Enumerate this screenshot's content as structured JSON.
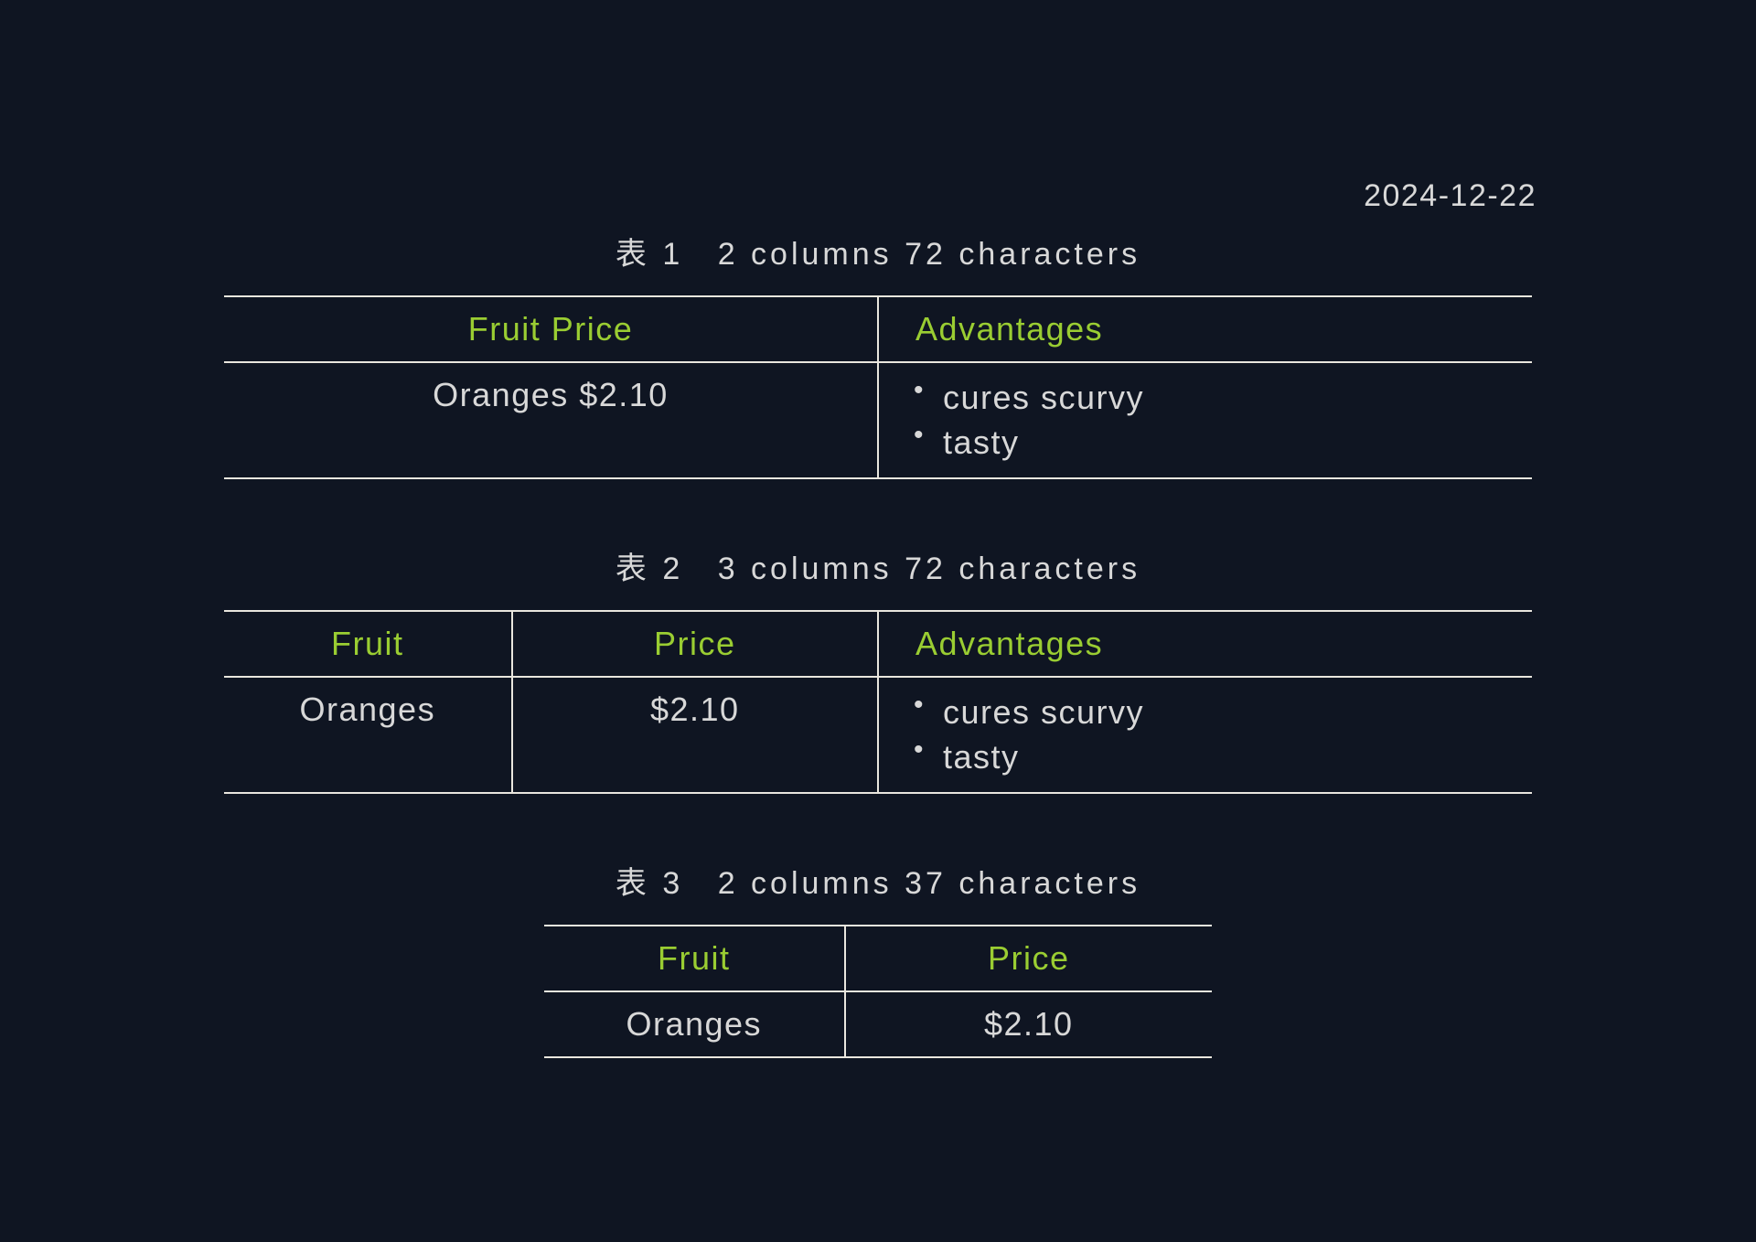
{
  "date": "2024-12-22",
  "table1": {
    "caption_label": "表 1",
    "caption_desc": "2 columns 72 characters",
    "headers": {
      "h1": "Fruit Price",
      "h2": "Advantages"
    },
    "row": {
      "fruit_price": "Oranges $2.10",
      "advantages": [
        "cures scurvy",
        "tasty"
      ]
    }
  },
  "table2": {
    "caption_label": "表 2",
    "caption_desc": "3 columns 72 characters",
    "headers": {
      "h1": "Fruit",
      "h2": "Price",
      "h3": "Advantages"
    },
    "row": {
      "fruit": "Oranges",
      "price": "$2.10",
      "advantages": [
        "cures scurvy",
        "tasty"
      ]
    }
  },
  "table3": {
    "caption_label": "表 3",
    "caption_desc": "2 columns 37 characters",
    "headers": {
      "h1": "Fruit",
      "h2": "Price"
    },
    "row": {
      "fruit": "Oranges",
      "price": "$2.10"
    }
  }
}
